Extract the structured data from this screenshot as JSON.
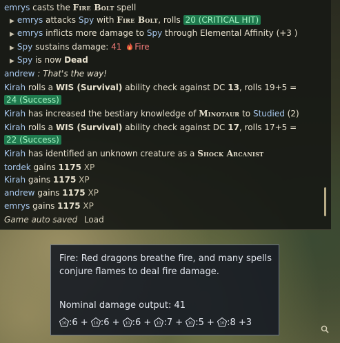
{
  "log": {
    "l1": {
      "name": "emrys",
      "text1": " casts the ",
      "spell": "Fire Bolt",
      "text2": " spell"
    },
    "l2": {
      "name": "emrys",
      "text1": " attacks ",
      "target": "Spy",
      "text2": " with ",
      "spell": "Fire Bolt",
      "text3": ", rolls ",
      "roll": "20 (CRITICAL HIT)"
    },
    "l3": {
      "name": "emrys",
      "text1": " inflicts more damage to ",
      "target": "Spy",
      "text2": " through Elemental Affinity (+3 )"
    },
    "l4": {
      "target": "Spy",
      "text1": " sustains damage: ",
      "dmg": "41",
      "dmg_type": "Fire"
    },
    "l5": {
      "target": "Spy",
      "text1": " is now ",
      "state": "Dead"
    },
    "l6": {
      "name": "andrew",
      "text1": " : ",
      "quote": "That's the way!"
    },
    "l7": {
      "name": "Kirah",
      "text1": " rolls a ",
      "stat": "WIS (Survival)",
      "text2": " ability check against DC ",
      "dc": "13",
      "text3": ", rolls 19+5 ="
    },
    "l8": {
      "result": "24 (Success)"
    },
    "l9": {
      "name": "Kirah",
      "text1": " has increased the bestiary knowledge of ",
      "creature": "Minotaur",
      "text2": " to ",
      "level": "Studied",
      "text3": " (2)"
    },
    "l10": {
      "name": "Kirah",
      "text1": " rolls a ",
      "stat": "WIS (Survival)",
      "text2": " ability check against DC ",
      "dc": "17",
      "text3": ", rolls 17+5 ="
    },
    "l11": {
      "result": "22 (Success)"
    },
    "l12": {
      "name": "Kirah",
      "text1": " has identified an unknown creature as a ",
      "creature": "Shock Arcanist"
    },
    "xp": [
      {
        "name": "tordek",
        "text1": " gains ",
        "amount": "1175",
        "unit": " XP"
      },
      {
        "name": "Kirah",
        "text1": " gains ",
        "amount": "1175",
        "unit": " XP"
      },
      {
        "name": "andrew",
        "text1": " gains ",
        "amount": "1175",
        "unit": " XP"
      },
      {
        "name": "emrys",
        "text1": " gains ",
        "amount": "1175",
        "unit": " XP"
      }
    ],
    "saved": "Game auto saved",
    "load": "Load"
  },
  "tooltip": {
    "description": "Fire: Red dragons breathe fire, and many spells conjure flames to deal fire damage.",
    "nominal": "Nominal damage output: 41",
    "dice_label": "10",
    "dice": [
      ":6 + ",
      ":6 + ",
      ":6 + ",
      ":7 + ",
      ":5 + ",
      ":8 +3"
    ]
  },
  "colors": {
    "name": "#a8c8ee",
    "highlight_bg": "#1f7a4e",
    "damage": "#f07a78"
  },
  "icons": [
    "arrow-bullet-icon",
    "fire-icon",
    "d10-die-icon",
    "search-icon"
  ]
}
